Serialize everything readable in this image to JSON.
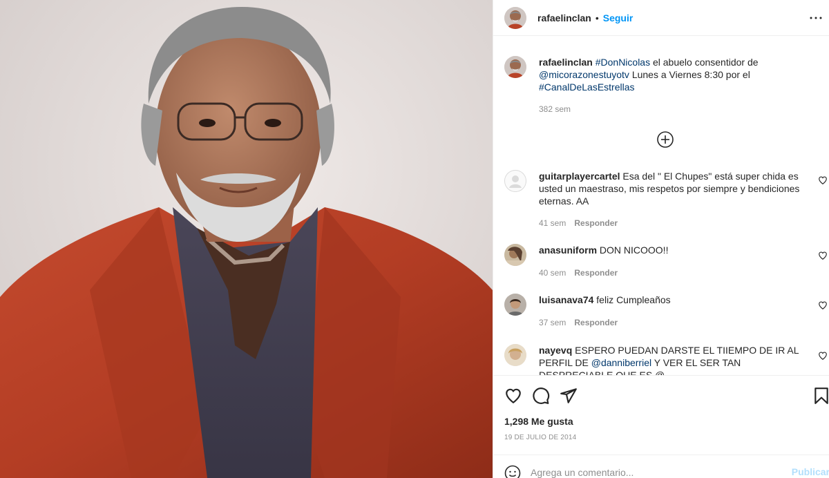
{
  "post": {
    "username": "rafaelinclan",
    "separator": "•",
    "follow_label": "Seguir"
  },
  "caption": {
    "username": "rafaelinclan",
    "tag1": "#DonNicolas",
    "text1": " el abuelo consentidor de ",
    "mention": "@micorazonestuyotv",
    "text2": " Lunes a Viernes 8:30 por el ",
    "tag2": "#CanalDeLasEstrellas",
    "time": "382 sem"
  },
  "comments": [
    {
      "username": "guitarplayercartel",
      "text": " Esa del \" El Chupes\" está super chida es usted un maestraso, mis respetos por siempre y bendiciones eternas. AA",
      "time": "41 sem",
      "reply": "Responder"
    },
    {
      "username": "anasuniform",
      "text": " DON NICOOO!!",
      "time": "40 sem",
      "reply": "Responder"
    },
    {
      "username": "luisanava74",
      "text": " feliz Cumpleaños",
      "time": "37 sem",
      "reply": "Responder"
    },
    {
      "username": "nayevq",
      "text1": " ESPERO PUEDAN DARSTE EL TIIEMPO DE IR AL PERFIL DE ",
      "mention": "@danniberriel",
      "text2": " Y VER EL SER TAN DESPRECIABLE QUE ES @"
    }
  ],
  "stats": {
    "likes": "1,298 Me gusta",
    "date": "19 DE JULIO DE 2014"
  },
  "add_comment": {
    "placeholder": "Agrega un comentario...",
    "publish": "Publicar"
  },
  "colors": {
    "accent": "#0095f6",
    "link": "#00376b",
    "muted": "#8e8e8e",
    "publish_disabled": "#b2dffc"
  },
  "icons": [
    "more-options-icon",
    "load-more-comments-icon",
    "heart-icon",
    "comment-icon",
    "share-icon",
    "bookmark-icon",
    "emoji-icon"
  ]
}
